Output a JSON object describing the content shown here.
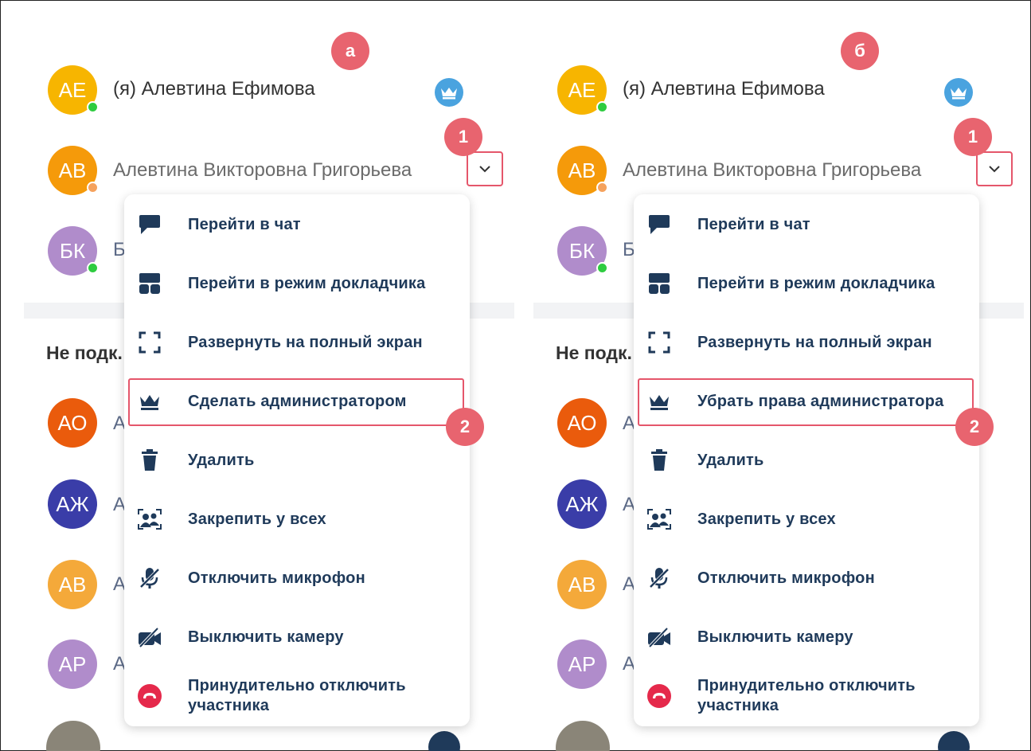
{
  "colors": {
    "accent_red": "#e8646f",
    "menu_text": "#1f3a5a",
    "crown_blue": "#4aa3df",
    "online": "#2ecc40",
    "away": "#f5a25d"
  },
  "panels": [
    {
      "marker": "а",
      "marker_1": "1",
      "marker_2": "2",
      "participants": [
        {
          "initials": "АЕ",
          "name": "(я) Алевтина Ефимова",
          "color": "#f7b500",
          "status": "online"
        },
        {
          "initials": "АВ",
          "name": "Алевтина Викторовна Григорьева",
          "color": "#f59a0a",
          "status": "away"
        },
        {
          "initials": "БК",
          "name": "Б",
          "color": "#b08ccb",
          "status": "online"
        }
      ],
      "section_title": "Не подк.",
      "others": [
        {
          "initials": "АО",
          "name": "А",
          "color": "#ea5b0c"
        },
        {
          "initials": "АЖ",
          "name": "А",
          "color": "#3a3da8"
        },
        {
          "initials": "АВ",
          "name": "А",
          "color": "#f4a93a"
        },
        {
          "initials": "АР",
          "name": "А",
          "color": "#b08ccb"
        }
      ],
      "menu": [
        {
          "label": "Перейти в чат",
          "icon": "chat-icon"
        },
        {
          "label": "Перейти в режим докладчика",
          "icon": "speaker-layout-icon"
        },
        {
          "label": "Развернуть на полный экран",
          "icon": "fullscreen-icon"
        },
        {
          "label": "Сделать администратором",
          "icon": "crown-icon"
        },
        {
          "label": "Удалить",
          "icon": "trash-icon"
        },
        {
          "label": "Закрепить у всех",
          "icon": "pin-people-icon"
        },
        {
          "label": "Отключить микрофон",
          "icon": "mic-off-icon"
        },
        {
          "label": "Выключить камеру",
          "icon": "camera-off-icon"
        },
        {
          "label": "Принудительно отключить участника",
          "icon": "hangup-icon"
        }
      ]
    },
    {
      "marker": "б",
      "marker_1": "1",
      "marker_2": "2",
      "participants": [
        {
          "initials": "АЕ",
          "name": "(я) Алевтина Ефимова",
          "color": "#f7b500",
          "status": "online"
        },
        {
          "initials": "АВ",
          "name": "Алевтина Викторовна Григорьева",
          "color": "#f59a0a",
          "status": "away"
        },
        {
          "initials": "БК",
          "name": "Б",
          "color": "#b08ccb",
          "status": "online"
        }
      ],
      "section_title": "Не подк.",
      "others": [
        {
          "initials": "АО",
          "name": "А",
          "color": "#ea5b0c"
        },
        {
          "initials": "АЖ",
          "name": "А",
          "color": "#3a3da8"
        },
        {
          "initials": "АВ",
          "name": "А",
          "color": "#f4a93a"
        },
        {
          "initials": "АР",
          "name": "А",
          "color": "#b08ccb"
        }
      ],
      "menu": [
        {
          "label": "Перейти в чат",
          "icon": "chat-icon"
        },
        {
          "label": "Перейти в режим докладчика",
          "icon": "speaker-layout-icon"
        },
        {
          "label": "Развернуть на полный экран",
          "icon": "fullscreen-icon"
        },
        {
          "label": "Убрать права администратора",
          "icon": "crown-icon"
        },
        {
          "label": "Удалить",
          "icon": "trash-icon"
        },
        {
          "label": "Закрепить у всех",
          "icon": "pin-people-icon"
        },
        {
          "label": "Отключить микрофон",
          "icon": "mic-off-icon"
        },
        {
          "label": "Выключить камеру",
          "icon": "camera-off-icon"
        },
        {
          "label": "Принудительно отключить участника",
          "icon": "hangup-icon"
        }
      ]
    }
  ]
}
